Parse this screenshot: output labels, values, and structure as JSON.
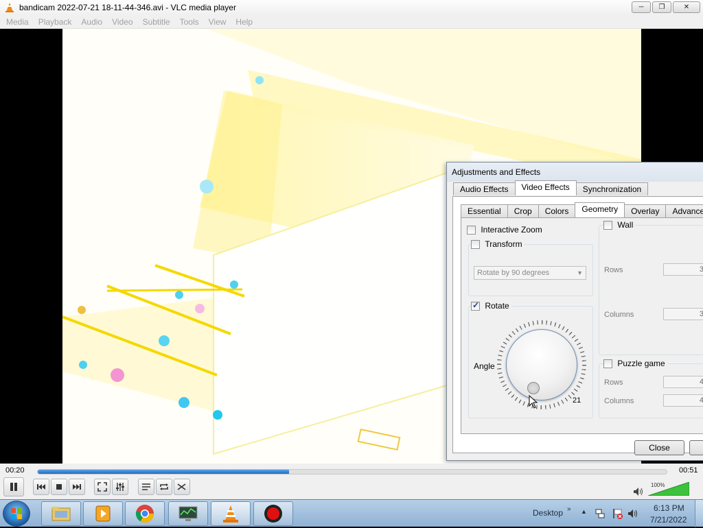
{
  "window": {
    "title": "bandicam 2022-07-21 18-11-44-346.avi - VLC media player"
  },
  "menu": [
    "Media",
    "Playback",
    "Audio",
    "Video",
    "Subtitle",
    "Tools",
    "View",
    "Help"
  ],
  "dialog": {
    "title": "Adjustments and Effects",
    "tabs": [
      "Audio Effects",
      "Video Effects",
      "Synchronization"
    ],
    "subtabs": [
      "Essential",
      "Crop",
      "Colors",
      "Geometry",
      "Overlay",
      "Advanced"
    ],
    "interactive_zoom": "Interactive Zoom",
    "transform": {
      "label": "Transform",
      "select": "Rotate by 90 degrees"
    },
    "rotate": {
      "label": "Rotate",
      "angle_label": "Angle",
      "angle_value": "21"
    },
    "wall": {
      "label": "Wall",
      "rows_label": "Rows",
      "rows": "3",
      "cols_label": "Columns",
      "cols": "3"
    },
    "puzzle": {
      "label": "Puzzle game",
      "rows_label": "Rows",
      "rows": "4",
      "cols_label": "Columns",
      "cols": "4"
    },
    "close_label": "Close"
  },
  "player": {
    "elapsed": "00:20",
    "total": "00:51",
    "progress": 0.4,
    "volume": "100%"
  },
  "taskbar": {
    "desktop_label": "Desktop",
    "time": "6:13 PM",
    "date": "7/21/2022"
  }
}
